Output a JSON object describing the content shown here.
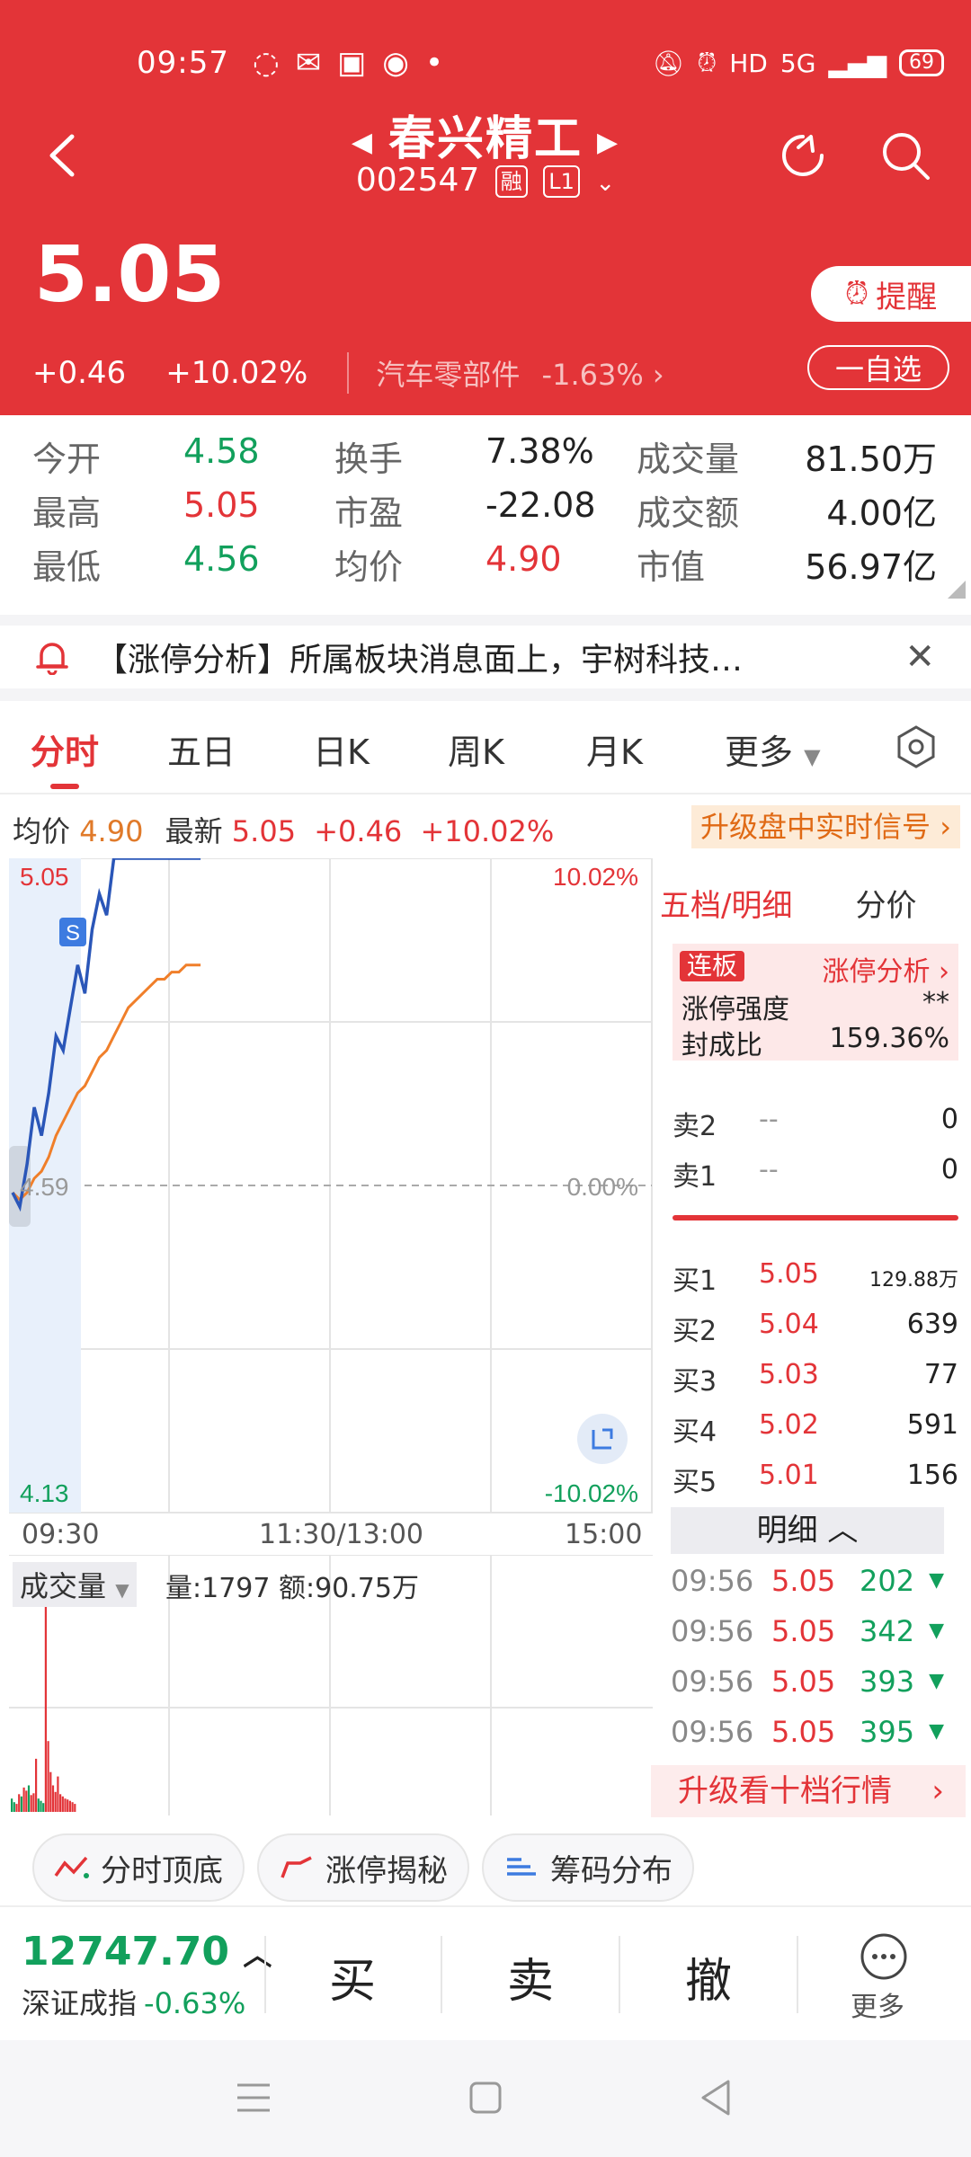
{
  "status_bar": {
    "time": "09:57",
    "network": "HD",
    "signal": "5G",
    "battery": "69"
  },
  "header": {
    "stock_name": "春兴精工",
    "stock_code": "002547",
    "tag_margin": "融",
    "tag_level": "L1",
    "price": "5.05",
    "change": "+0.46",
    "change_pct": "+10.02%",
    "sector": "汽车零部件",
    "sector_change": "-1.63%",
    "remind_label": "提醒",
    "favorite_label": "一自选"
  },
  "quote": {
    "open_label": "今开",
    "open": "4.58",
    "high_label": "最高",
    "high": "5.05",
    "low_label": "最低",
    "low": "4.56",
    "turnover_label": "换手",
    "turnover": "7.38%",
    "pe_label": "市盈",
    "pe": "-22.08",
    "avg_label": "均价",
    "avg": "4.90",
    "volume_label": "成交量",
    "volume": "81.50万",
    "amount_label": "成交额",
    "amount": "4.00亿",
    "mcap_label": "市值",
    "mcap": "56.97亿"
  },
  "news": {
    "text": "【涨停分析】所属板块消息面上，宇树科技…"
  },
  "tabs": [
    "分时",
    "五日",
    "日K",
    "周K",
    "月K",
    "更多"
  ],
  "info_line": {
    "avg_label": "均价",
    "avg": "4.90",
    "latest_label": "最新",
    "latest": "5.05",
    "change": "+0.46",
    "change_pct": "+10.02%",
    "upgrade_signal": "升级盘中实时信号"
  },
  "chart": {
    "y_top_label": "5.05",
    "y_mid_label": "4.59",
    "y_bottom_label": "4.13",
    "pct_top": "10.02%",
    "pct_mid": "0.00%",
    "pct_bottom": "-10.02%",
    "x_labels": [
      "09:30",
      "11:30/13:00",
      "15:00"
    ],
    "marker": "S",
    "volume_selector": "成交量",
    "volume_info": "量:1797 额:90.75万"
  },
  "chart_data": {
    "type": "line",
    "title": "",
    "series": [
      {
        "name": "",
        "x": [
          "09:30",
          "09:31",
          "09:32",
          "09:33",
          "09:34",
          "09:35",
          "09:36",
          "09:37",
          "09:38",
          "09:39",
          "09:40",
          "09:41",
          "09:42",
          "09:43",
          "09:44",
          "09:45",
          "09:46",
          "09:47",
          "09:48",
          "09:49",
          "09:50",
          "09:51",
          "09:52",
          "09:53",
          "09:54",
          "09:55",
          "09:56"
        ],
        "values": [
          4.58,
          4.56,
          4.62,
          4.7,
          4.66,
          4.72,
          4.8,
          4.78,
          4.84,
          4.9,
          4.86,
          4.95,
          5.0,
          4.97,
          5.05,
          5.05,
          5.05,
          5.05,
          5.05,
          5.05,
          5.05,
          5.05,
          5.05,
          5.05,
          5.05,
          5.05,
          5.05
        ]
      },
      {
        "name": "",
        "x": [
          "09:30",
          "09:31",
          "09:32",
          "09:33",
          "09:34",
          "09:35",
          "09:36",
          "09:37",
          "09:38",
          "09:39",
          "09:40",
          "09:41",
          "09:42",
          "09:43",
          "09:44",
          "09:45",
          "09:46",
          "09:47",
          "09:48",
          "09:49",
          "09:50",
          "09:51",
          "09:52",
          "09:53",
          "09:54",
          "09:55",
          "09:56"
        ],
        "values": [
          4.58,
          4.57,
          4.58,
          4.6,
          4.61,
          4.63,
          4.66,
          4.68,
          4.7,
          4.72,
          4.73,
          4.75,
          4.77,
          4.78,
          4.8,
          4.82,
          4.84,
          4.85,
          4.86,
          4.87,
          4.88,
          4.88,
          4.89,
          4.89,
          4.9,
          4.9,
          4.9
        ]
      }
    ],
    "ylim": [
      4.13,
      5.05
    ],
    "volume": [
      30,
      22,
      18,
      40,
      35,
      55,
      48,
      60,
      38,
      42,
      120,
      30,
      25,
      20,
      520,
      160,
      90,
      60,
      45,
      80,
      40,
      35,
      30,
      28,
      25,
      22,
      18
    ],
    "volume_colors": [
      "g",
      "g",
      "r",
      "r",
      "g",
      "r",
      "r",
      "g",
      "r",
      "r",
      "r",
      "g",
      "g",
      "g",
      "r",
      "r",
      "r",
      "r",
      "r",
      "r",
      "r",
      "r",
      "r",
      "r",
      "r",
      "r",
      "r"
    ]
  },
  "order_book": {
    "tab_active": "五档/明细",
    "tab_other": "分价",
    "limit_tag": "连板",
    "limit_link": "涨停分析",
    "strength_label": "涨停强度",
    "strength": "**",
    "seal_label": "封成比",
    "seal": "159.36%",
    "asks": [
      {
        "label": "卖2",
        "price": "--",
        "vol": "0"
      },
      {
        "label": "卖1",
        "price": "--",
        "vol": "0"
      }
    ],
    "bids": [
      {
        "label": "买1",
        "price": "5.05",
        "vol": "129.88万"
      },
      {
        "label": "买2",
        "price": "5.04",
        "vol": "639"
      },
      {
        "label": "买3",
        "price": "5.03",
        "vol": "77"
      },
      {
        "label": "买4",
        "price": "5.02",
        "vol": "591"
      },
      {
        "label": "买5",
        "price": "5.01",
        "vol": "156"
      }
    ],
    "detail_label": "明细",
    "ticks": [
      {
        "time": "09:56",
        "price": "5.05",
        "vol": "202"
      },
      {
        "time": "09:56",
        "price": "5.05",
        "vol": "342"
      },
      {
        "time": "09:56",
        "price": "5.05",
        "vol": "393"
      },
      {
        "time": "09:56",
        "price": "5.05",
        "vol": "395"
      }
    ],
    "upgrade_10": "升级看十档行情"
  },
  "tools": [
    "分时顶底",
    "涨停揭秘",
    "筹码分布"
  ],
  "bottom": {
    "index_value": "12747.70",
    "index_name": "深证成指",
    "index_change": "-0.63%",
    "buy": "买",
    "sell": "卖",
    "cancel": "撤",
    "more": "更多"
  }
}
